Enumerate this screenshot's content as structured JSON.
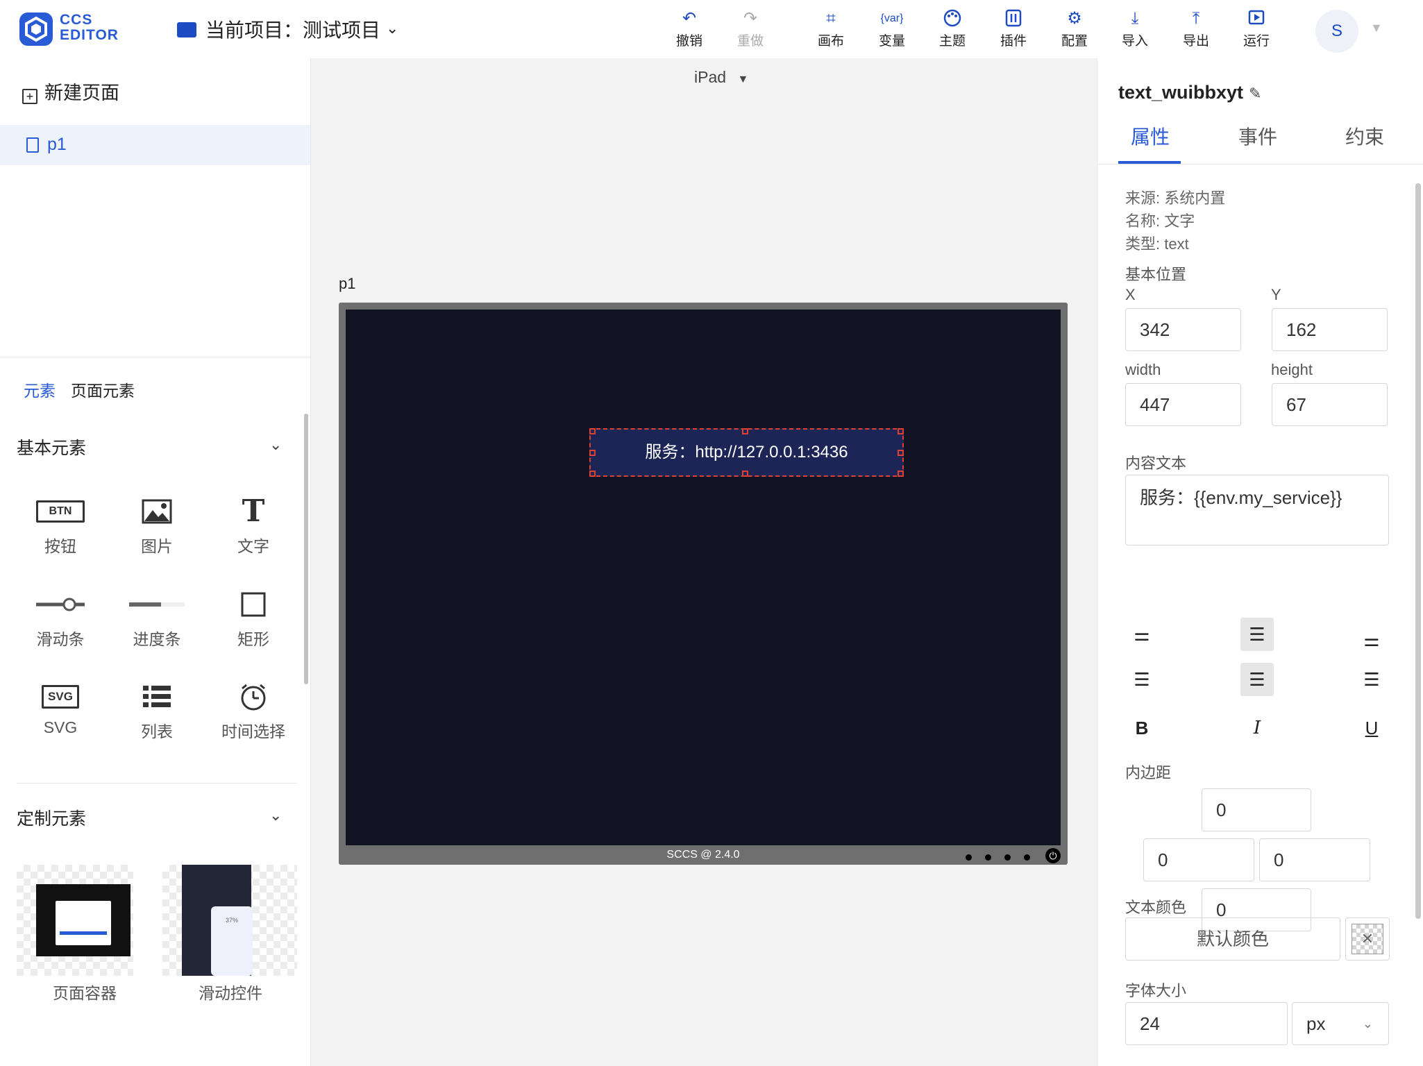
{
  "header": {
    "logo_line1": "CCS",
    "logo_line2": "EDITOR",
    "project_title": "当前项目：测试项目",
    "toolbar": [
      {
        "name": "undo",
        "label": "撤销",
        "icon": "↶",
        "enabled": true
      },
      {
        "name": "redo",
        "label": "重做",
        "icon": "↷",
        "enabled": false
      },
      {
        "name": "canvas",
        "label": "画布",
        "icon": "⌗",
        "enabled": true
      },
      {
        "name": "variables",
        "label": "变量",
        "icon": "{var}",
        "enabled": true
      },
      {
        "name": "theme",
        "label": "主题",
        "icon": "🎨",
        "enabled": true
      },
      {
        "name": "plugins",
        "label": "插件",
        "icon": "⚙",
        "enabled": true
      },
      {
        "name": "config",
        "label": "配置",
        "icon": "⚙",
        "enabled": true
      },
      {
        "name": "import",
        "label": "导入",
        "icon": "⤓",
        "enabled": true
      },
      {
        "name": "export",
        "label": "导出",
        "icon": "⤒",
        "enabled": true
      },
      {
        "name": "run",
        "label": "运行",
        "icon": "▶",
        "enabled": true
      }
    ],
    "avatar_initial": "S"
  },
  "left": {
    "new_page_label": "新建页面",
    "pages": [
      {
        "label": "p1"
      }
    ],
    "element_tabs": [
      {
        "label": "元素",
        "active": true
      },
      {
        "label": "页面元素",
        "active": false
      }
    ],
    "basic_section_title": "基本元素",
    "basic_elements": [
      {
        "label": "按钮",
        "icon": "BTN"
      },
      {
        "label": "图片",
        "icon": "image-icon"
      },
      {
        "label": "文字",
        "icon": "T"
      },
      {
        "label": "滑动条",
        "icon": "slider-icon"
      },
      {
        "label": "进度条",
        "icon": "progress-icon"
      },
      {
        "label": "矩形",
        "icon": "rect-icon"
      },
      {
        "label": "SVG",
        "icon": "SVG"
      },
      {
        "label": "列表",
        "icon": "list-icon"
      },
      {
        "label": "时间选择",
        "icon": "clock-icon"
      }
    ],
    "custom_section_title": "定制元素",
    "custom_elements": [
      {
        "label": "页面容器"
      },
      {
        "label": "滑动控件",
        "thumb_text": "37%"
      }
    ]
  },
  "canvas": {
    "device": "iPad",
    "page_name": "p1",
    "selected_text": "服务：http://127.0.0.1:3436",
    "footer": "SCCS @ 2.4.0"
  },
  "inspector": {
    "component_name": "text_wuibbxyt",
    "tabs": [
      {
        "label": "属性",
        "active": true
      },
      {
        "label": "事件",
        "active": false
      },
      {
        "label": "约束",
        "active": false
      }
    ],
    "source": "来源: 系统内置",
    "name": "名称: 文字",
    "type": "类型: text",
    "position_title": "基本位置",
    "x_label": "X",
    "x_value": "342",
    "y_label": "Y",
    "y_value": "162",
    "width_label": "width",
    "width_value": "447",
    "height_label": "height",
    "height_value": "67",
    "content_label": "内容文本",
    "content_value": "服务：{{env.my_service}}",
    "padding_label": "内边距",
    "padding": {
      "top": "0",
      "left": "0",
      "right": "0",
      "bottom": "0"
    },
    "text_color_label": "文本颜色",
    "text_color_button": "默认颜色",
    "font_size_label": "字体大小",
    "font_size_value": "24",
    "font_size_unit": "px"
  },
  "colors": {
    "accent": "#2a5bd7",
    "canvas_screen": "#121322",
    "selection_fill": "#1c2555",
    "selection_border": "#e0412f"
  }
}
